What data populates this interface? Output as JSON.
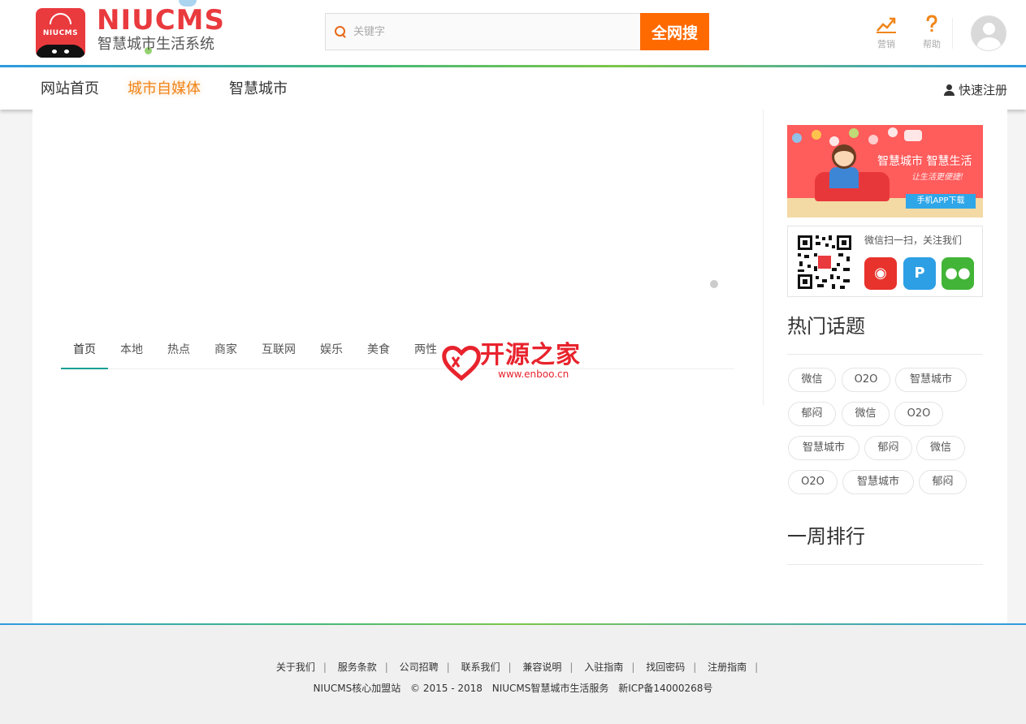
{
  "header": {
    "logo_small": "NIUCMS",
    "brand": "NIUCMS",
    "brand_sub": "智慧城市生活系统",
    "search_placeholder": "关键字",
    "search_button": "全网搜",
    "tools": [
      {
        "label": "营销",
        "icon": "chart-up-icon"
      },
      {
        "label": "帮助",
        "icon": "question-icon"
      }
    ],
    "accent": "#ff6a00"
  },
  "nav": {
    "items": [
      {
        "label": "网站首页",
        "active": false
      },
      {
        "label": "城市自媒体",
        "active": true
      },
      {
        "label": "智慧城市",
        "active": false
      }
    ],
    "register": "快速注册"
  },
  "main": {
    "tabs": [
      {
        "label": "首页",
        "active": true
      },
      {
        "label": "本地",
        "active": false
      },
      {
        "label": "热点",
        "active": false
      },
      {
        "label": "商家",
        "active": false
      },
      {
        "label": "互联网",
        "active": false
      },
      {
        "label": "娱乐",
        "active": false
      },
      {
        "label": "美食",
        "active": false
      },
      {
        "label": "两性",
        "active": false
      }
    ],
    "watermark_text": "开源之家",
    "watermark_url": "www.enboo.cn"
  },
  "sidebar": {
    "banner": {
      "title": "智慧城市 智慧生活",
      "slogan": "让生活更便捷!",
      "button": "手机APP下载"
    },
    "wechat_text": "微信扫一扫，关注我们",
    "hot_topics_title": "热门话题",
    "tags": [
      "微信",
      "O2O",
      "智慧城市",
      "郁闷",
      "微信",
      "O2O",
      "智慧城市",
      "郁闷",
      "微信",
      "O2O",
      "智慧城市",
      "郁闷"
    ],
    "weekly_title": "一周排行"
  },
  "footer": {
    "links": [
      "关于我们",
      "服务条款",
      "公司招聘",
      "联系我们",
      "兼容说明",
      "入驻指南",
      "找回密码",
      "注册指南"
    ],
    "site": "NIUCMS核心加盟站",
    "copyright": "© 2015 - 2018",
    "service": "NIUCMS智慧城市生活服务",
    "icp": "新ICP备14000268号"
  }
}
